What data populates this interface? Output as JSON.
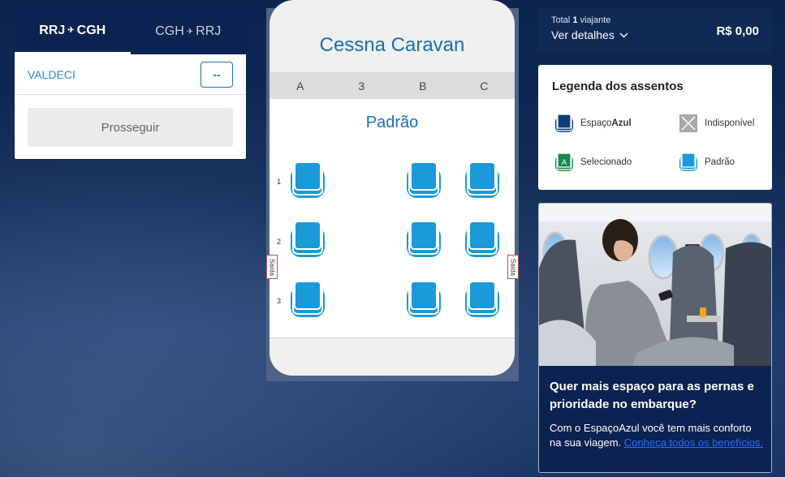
{
  "segments": {
    "outbound": {
      "origin": "RRJ",
      "destination": "CGH"
    },
    "return": {
      "origin": "CGH",
      "destination": "RRJ"
    },
    "arrow": "✈"
  },
  "passenger": {
    "name": "VALDECI",
    "seat": "--"
  },
  "proceed_label": "Prosseguir",
  "aircraft": {
    "name": "Cessna Caravan",
    "columns": [
      "A",
      "3",
      "B",
      "C"
    ],
    "class_name": "Padrão",
    "exit_label": "Saída",
    "rows": [
      "1",
      "2",
      "3"
    ]
  },
  "summary": {
    "total_prefix": "Total",
    "traveler_count": "1",
    "traveler_label": "viajante",
    "details_label": "Ver detalhes",
    "price": "R$ 0,00"
  },
  "legend": {
    "title": "Legenda dos assentos",
    "espaco_prefix": "Espaço",
    "espaco_bold": "Azul",
    "unavailable": "Indisponível",
    "selected": "Selecionado",
    "standard": "Padrão",
    "selected_seat_letter": "A"
  },
  "promo": {
    "title": "Quer mais espaço para as pernas e prioridade no embarque?",
    "text": "Com o EspaçoAzul você tem mais conforto na sua viagem.",
    "link": "Conheça todos os benefícios."
  },
  "colors": {
    "navy": "#0a2350",
    "seat_blue": "#1a9ad8",
    "link_blue": "#1a6fb4",
    "selected_green": "#1a8a50",
    "espaco_navy": "#0f3d78"
  }
}
